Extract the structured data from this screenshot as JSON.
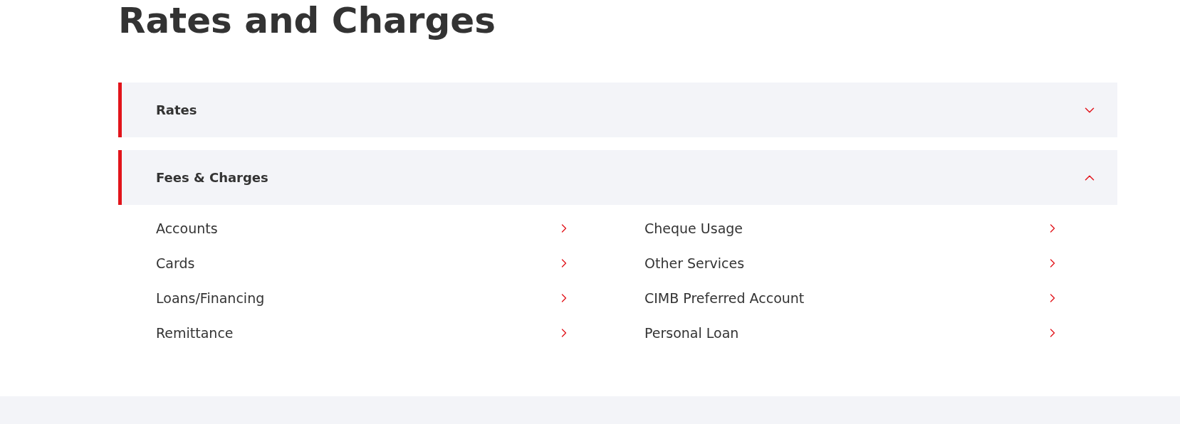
{
  "title": "Rates and Charges",
  "sections": [
    {
      "title": "Rates",
      "expanded": false
    },
    {
      "title": "Fees & Charges",
      "expanded": true,
      "links": [
        "Accounts",
        "Cards",
        "Loans/Financing",
        "Remittance",
        "Cheque Usage",
        "Other Services",
        "CIMB Preferred Account",
        "Personal Loan"
      ]
    }
  ]
}
